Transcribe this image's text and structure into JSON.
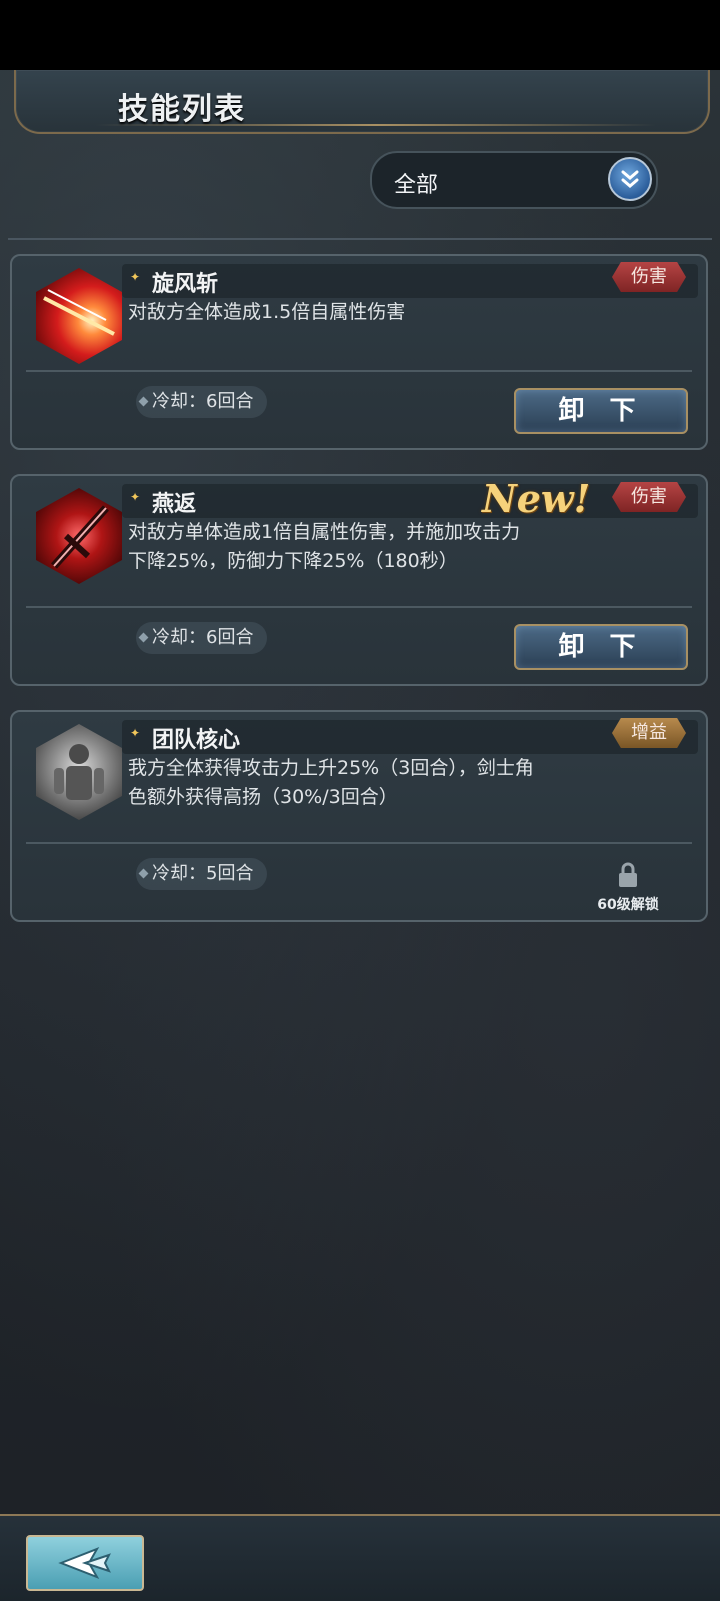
{
  "header": {
    "title": "技能列表"
  },
  "filter": {
    "label": "全部"
  },
  "skills": [
    {
      "name": "旋风斩",
      "tag": "伤害",
      "description": "对敌方全体造成1.5倍自属性伤害",
      "cooldown": "冷却：6回合",
      "action": "卸 下"
    },
    {
      "name": "燕返",
      "tag": "伤害",
      "badge": "New!",
      "description": "对敌方单体造成1倍自属性伤害，并施加攻击力下降25%，防御力下降25%（180秒）",
      "cooldown": "冷却：6回合",
      "action": "卸 下"
    },
    {
      "name": "团队核心",
      "tag": "增益",
      "description": "我方全体获得攻击力上升25%（3回合），剑士角色额外获得高扬（30%/3回合）",
      "cooldown": "冷却：5回合",
      "lock_text": "60级解锁"
    }
  ],
  "colors": {
    "damage_tag": "#b54444",
    "buff_tag": "#b78a4d",
    "button_border": "#a89063"
  }
}
